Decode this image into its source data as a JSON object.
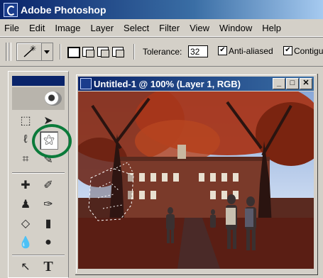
{
  "app": {
    "title": "Adobe Photoshop"
  },
  "menu": [
    "File",
    "Edit",
    "Image",
    "Layer",
    "Select",
    "Filter",
    "View",
    "Window",
    "Help"
  ],
  "options": {
    "tolerance_label": "Tolerance:",
    "tolerance_value": "32",
    "anti_aliased_label": "Anti-aliased",
    "anti_aliased_checked": true,
    "contiguous_label": "Contigu",
    "contiguous_checked": true
  },
  "toolbox": {
    "selected_tool": "magic-wand",
    "highlight_color": "#0b7a3a",
    "tools": [
      {
        "name": "marquee-tool-icon",
        "glyph": "⬚"
      },
      {
        "name": "move-tool-icon",
        "glyph": "➤"
      },
      {
        "name": "lasso-tool-icon",
        "glyph": "ℓ"
      },
      {
        "name": "magic-wand-tool-icon",
        "glyph": "⚝"
      },
      {
        "name": "crop-tool-icon",
        "glyph": "⌗"
      },
      {
        "name": "slice-tool-icon",
        "glyph": "✎"
      },
      {
        "name": "healing-brush-tool-icon",
        "glyph": "✚"
      },
      {
        "name": "brush-tool-icon",
        "glyph": "✐"
      },
      {
        "name": "stamp-tool-icon",
        "glyph": "♟"
      },
      {
        "name": "history-brush-tool-icon",
        "glyph": "✑"
      },
      {
        "name": "eraser-tool-icon",
        "glyph": "◇"
      },
      {
        "name": "gradient-tool-icon",
        "glyph": "▮"
      },
      {
        "name": "blur-tool-icon",
        "glyph": "💧"
      },
      {
        "name": "dodge-tool-icon",
        "glyph": "●"
      },
      {
        "name": "path-select-tool-icon",
        "glyph": "↖"
      },
      {
        "name": "type-tool-icon",
        "glyph": "T"
      }
    ]
  },
  "document": {
    "title": "Untitled-1 @ 100% (Layer 1, RGB)",
    "min_label": "_",
    "max_label": "□",
    "close_label": "✕"
  },
  "colors": {
    "title_bar": "#0a246a",
    "accent": "#3a6ea5",
    "chrome": "#d4d0c8"
  }
}
